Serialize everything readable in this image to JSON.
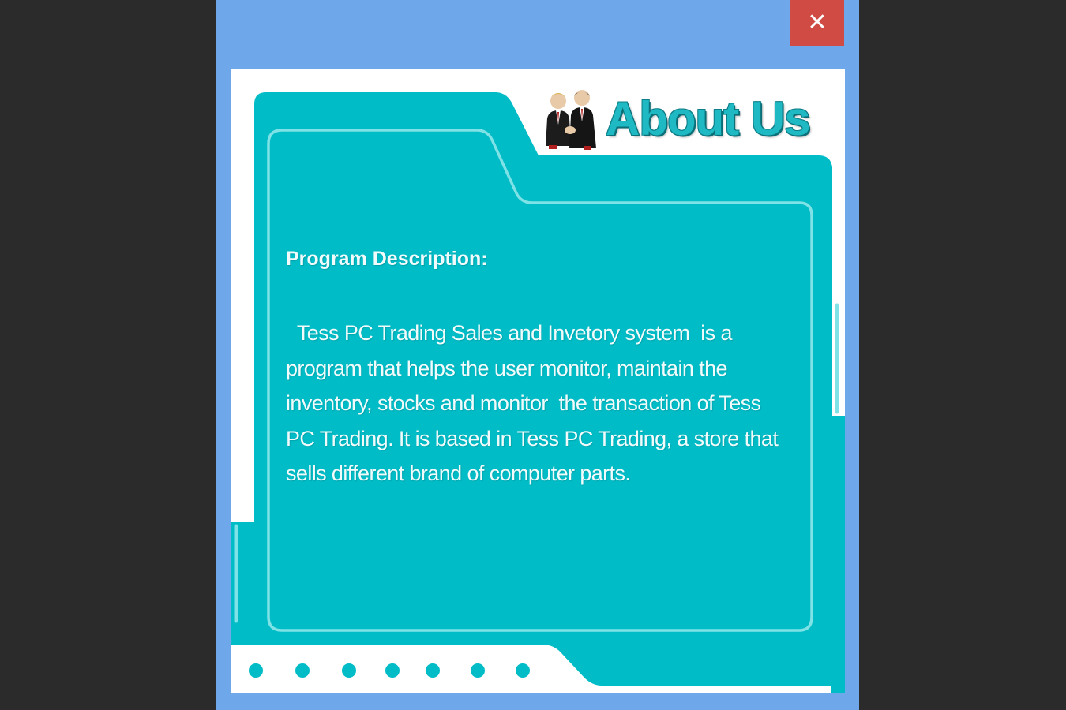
{
  "window": {
    "close_label": "✕"
  },
  "about": {
    "title": "About Us",
    "section_heading": "Program Description:",
    "description": "  Tess PC Trading Sales and Invetory system  is a program that helps the user monitor, maintain the inventory, stocks and monitor  the transaction of Tess PC Trading. It is based in Tess PC Trading, a store that sells different brand of computer parts."
  },
  "colors": {
    "window_frame": "#6fa8ea",
    "close_button": "#cf4b43",
    "panel_teal": "#00bcc6",
    "outline": "#7fe2e6",
    "background": "#2b2b2b"
  },
  "icons": {
    "heading_icon": "business-people-icon",
    "close_icon": "close-icon"
  }
}
